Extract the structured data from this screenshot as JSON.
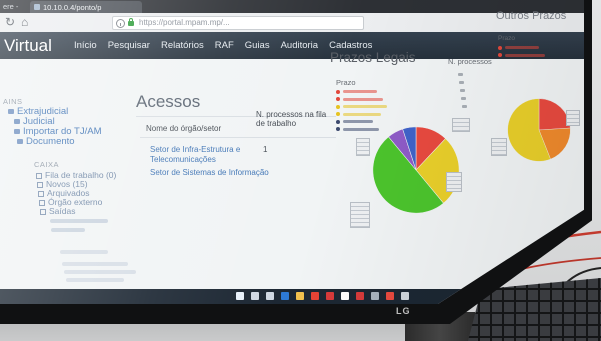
{
  "browser": {
    "tab_prefix": "ere -",
    "tab_title": "10.10.0.4/ponto/p",
    "url": "https://portal.mpam.mp/..."
  },
  "navbar": {
    "brand": "Virtual",
    "items": [
      "Início",
      "Pesquisar",
      "Relatórios",
      "RAF",
      "Guias",
      "Auditoria",
      "Cadastros"
    ]
  },
  "sidebar": {
    "group1_label": "AINS",
    "group1_items": [
      "Extrajudicial",
      "Judicial",
      "Importar do TJ/AM",
      "Documento"
    ],
    "group2_label": "CAIXA",
    "group2_items": [
      "Fila de trabalho (0)",
      "Novos (15)",
      "Arquivados",
      "Órgão externo",
      "Saídas"
    ]
  },
  "acessos": {
    "title": "Acessos",
    "col_name": "Nome do órgão/setor",
    "col_count": "N. processos na fila de trabalho",
    "rows": [
      {
        "name": "Setor de Infra-Estrutura e Telecomunicações",
        "count": "1"
      },
      {
        "name": "Setor de Sistemas de Informação"
      }
    ]
  },
  "prazos_legais": {
    "title": "Prazos Legais",
    "legend_title": "Prazo",
    "count_header": "N. processos",
    "legend_colors": [
      "#e2473b",
      "#e2473b",
      "#e6c321",
      "#e6c321",
      "#3c4a6e",
      "#3c4a6e"
    ],
    "slices": [
      {
        "color": "#e84a3f",
        "fraction": 0.12
      },
      {
        "color": "#e9cf2a",
        "fraction": 0.27
      },
      {
        "color": "#4cc42d",
        "fraction": 0.5
      },
      {
        "color": "#8e5bc7",
        "fraction": 0.06
      },
      {
        "color": "#3f63c9",
        "fraction": 0.05
      }
    ]
  },
  "outros_prazos": {
    "title": "Outros Prazos",
    "legend_title": "Prazo",
    "legend_colors": [
      "#e2473b",
      "#e2473b"
    ],
    "slices": [
      {
        "color": "#e84a3f",
        "fraction": 0.24
      },
      {
        "color": "#f08a2c",
        "fraction": 0.2
      },
      {
        "color": "#e9cf2a",
        "fraction": 0.56
      }
    ]
  },
  "taskbar": {
    "icons": [
      {
        "name": "windows-icon",
        "color": "#e8f1fb"
      },
      {
        "name": "search-icon",
        "color": "#cfd8e3"
      },
      {
        "name": "task-view-icon",
        "color": "#cfd8e3"
      },
      {
        "name": "taskbar-app-icon",
        "color": "#2d7ad6"
      },
      {
        "name": "taskbar-app-icon",
        "color": "#f2c14e"
      },
      {
        "name": "taskbar-app-icon",
        "color": "#e54335"
      },
      {
        "name": "taskbar-app-icon",
        "color": "#d83b3b"
      },
      {
        "name": "taskbar-app-icon",
        "color": "#ffffff"
      },
      {
        "name": "taskbar-app-icon",
        "color": "#d83b3b"
      },
      {
        "name": "taskbar-app-icon",
        "color": "#a8b3bf"
      },
      {
        "name": "taskbar-app-icon",
        "color": "#e84a3f"
      },
      {
        "name": "taskbar-app-icon",
        "color": "#d0d6dd"
      }
    ]
  },
  "bezel": {
    "logo": "LG"
  },
  "theme": {
    "navbar": "#34414f",
    "link": "#3f74b5",
    "heading": "#5b6572"
  }
}
